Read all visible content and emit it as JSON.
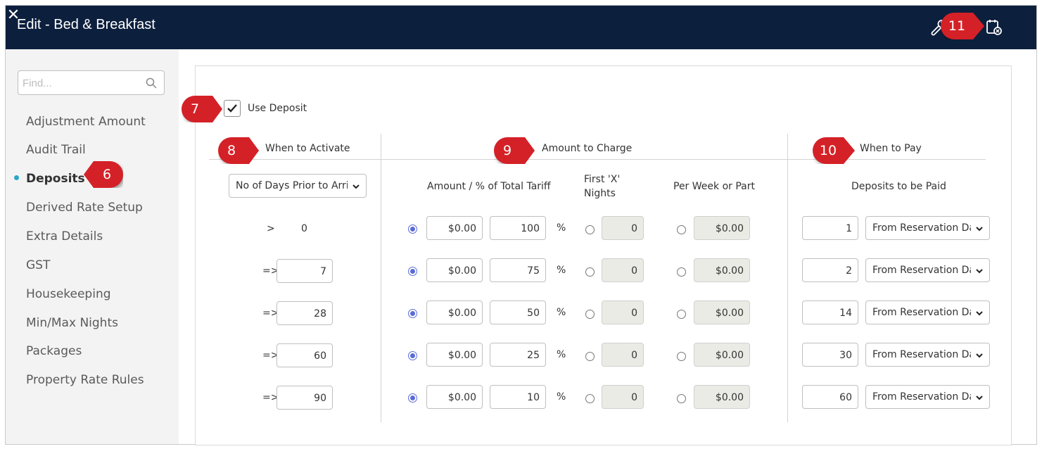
{
  "window": {
    "title": "Edit - Bed & Breakfast"
  },
  "sidebar": {
    "search_placeholder": "Find...",
    "items": [
      {
        "label": "Adjustment Amount"
      },
      {
        "label": "Audit Trail"
      },
      {
        "label": "Deposits"
      },
      {
        "label": "Derived Rate Setup"
      },
      {
        "label": "Extra Details"
      },
      {
        "label": "GST"
      },
      {
        "label": "Housekeeping"
      },
      {
        "label": "Min/Max Nights"
      },
      {
        "label": "Packages"
      },
      {
        "label": "Property Rate Rules"
      }
    ],
    "active": "Deposits"
  },
  "form": {
    "use_deposit_label": "Use Deposit",
    "use_deposit_checked": true,
    "sections": {
      "when_to_activate": "When to Activate",
      "amount_to_charge": "Amount to Charge",
      "when_to_pay": "When to Pay"
    },
    "activate_select": "No of Days Prior to Arrival",
    "columns": {
      "amount_pct": "Amount / % of Total Tariff",
      "first_x_line1": "First 'X'",
      "first_x_line2": "Nights",
      "per_week": "Per Week or Part",
      "deposits_to_be_paid": "Deposits to be Paid"
    },
    "pct_symbol": "%",
    "rows": [
      {
        "op": ">",
        "days": "0",
        "amount": "$0.00",
        "percent": "100",
        "first_x": "0",
        "per_week": "$0.00",
        "pay_days": "1",
        "pay_from": "From Reservation Date"
      },
      {
        "op": "=>",
        "days": "7",
        "amount": "$0.00",
        "percent": "75",
        "first_x": "0",
        "per_week": "$0.00",
        "pay_days": "2",
        "pay_from": "From Reservation Date"
      },
      {
        "op": "=>",
        "days": "28",
        "amount": "$0.00",
        "percent": "50",
        "first_x": "0",
        "per_week": "$0.00",
        "pay_days": "14",
        "pay_from": "From Reservation Date"
      },
      {
        "op": "=>",
        "days": "60",
        "amount": "$0.00",
        "percent": "25",
        "first_x": "0",
        "per_week": "$0.00",
        "pay_days": "30",
        "pay_from": "From Reservation Date"
      },
      {
        "op": "=>",
        "days": "90",
        "amount": "$0.00",
        "percent": "10",
        "first_x": "0",
        "per_week": "$0.00",
        "pay_days": "60",
        "pay_from": "From Reservation Date"
      }
    ]
  },
  "callouts": [
    "6",
    "7",
    "8",
    "9",
    "10",
    "11"
  ],
  "icons": {
    "header": [
      "wrench-icon",
      "save-calendar-icon",
      "close-icon"
    ],
    "search": "search-icon"
  },
  "colors": {
    "header_bg": "#0c1f3d",
    "callout": "#d42127",
    "active_dot": "#2aa6c6",
    "radio": "#5b6bd6"
  }
}
